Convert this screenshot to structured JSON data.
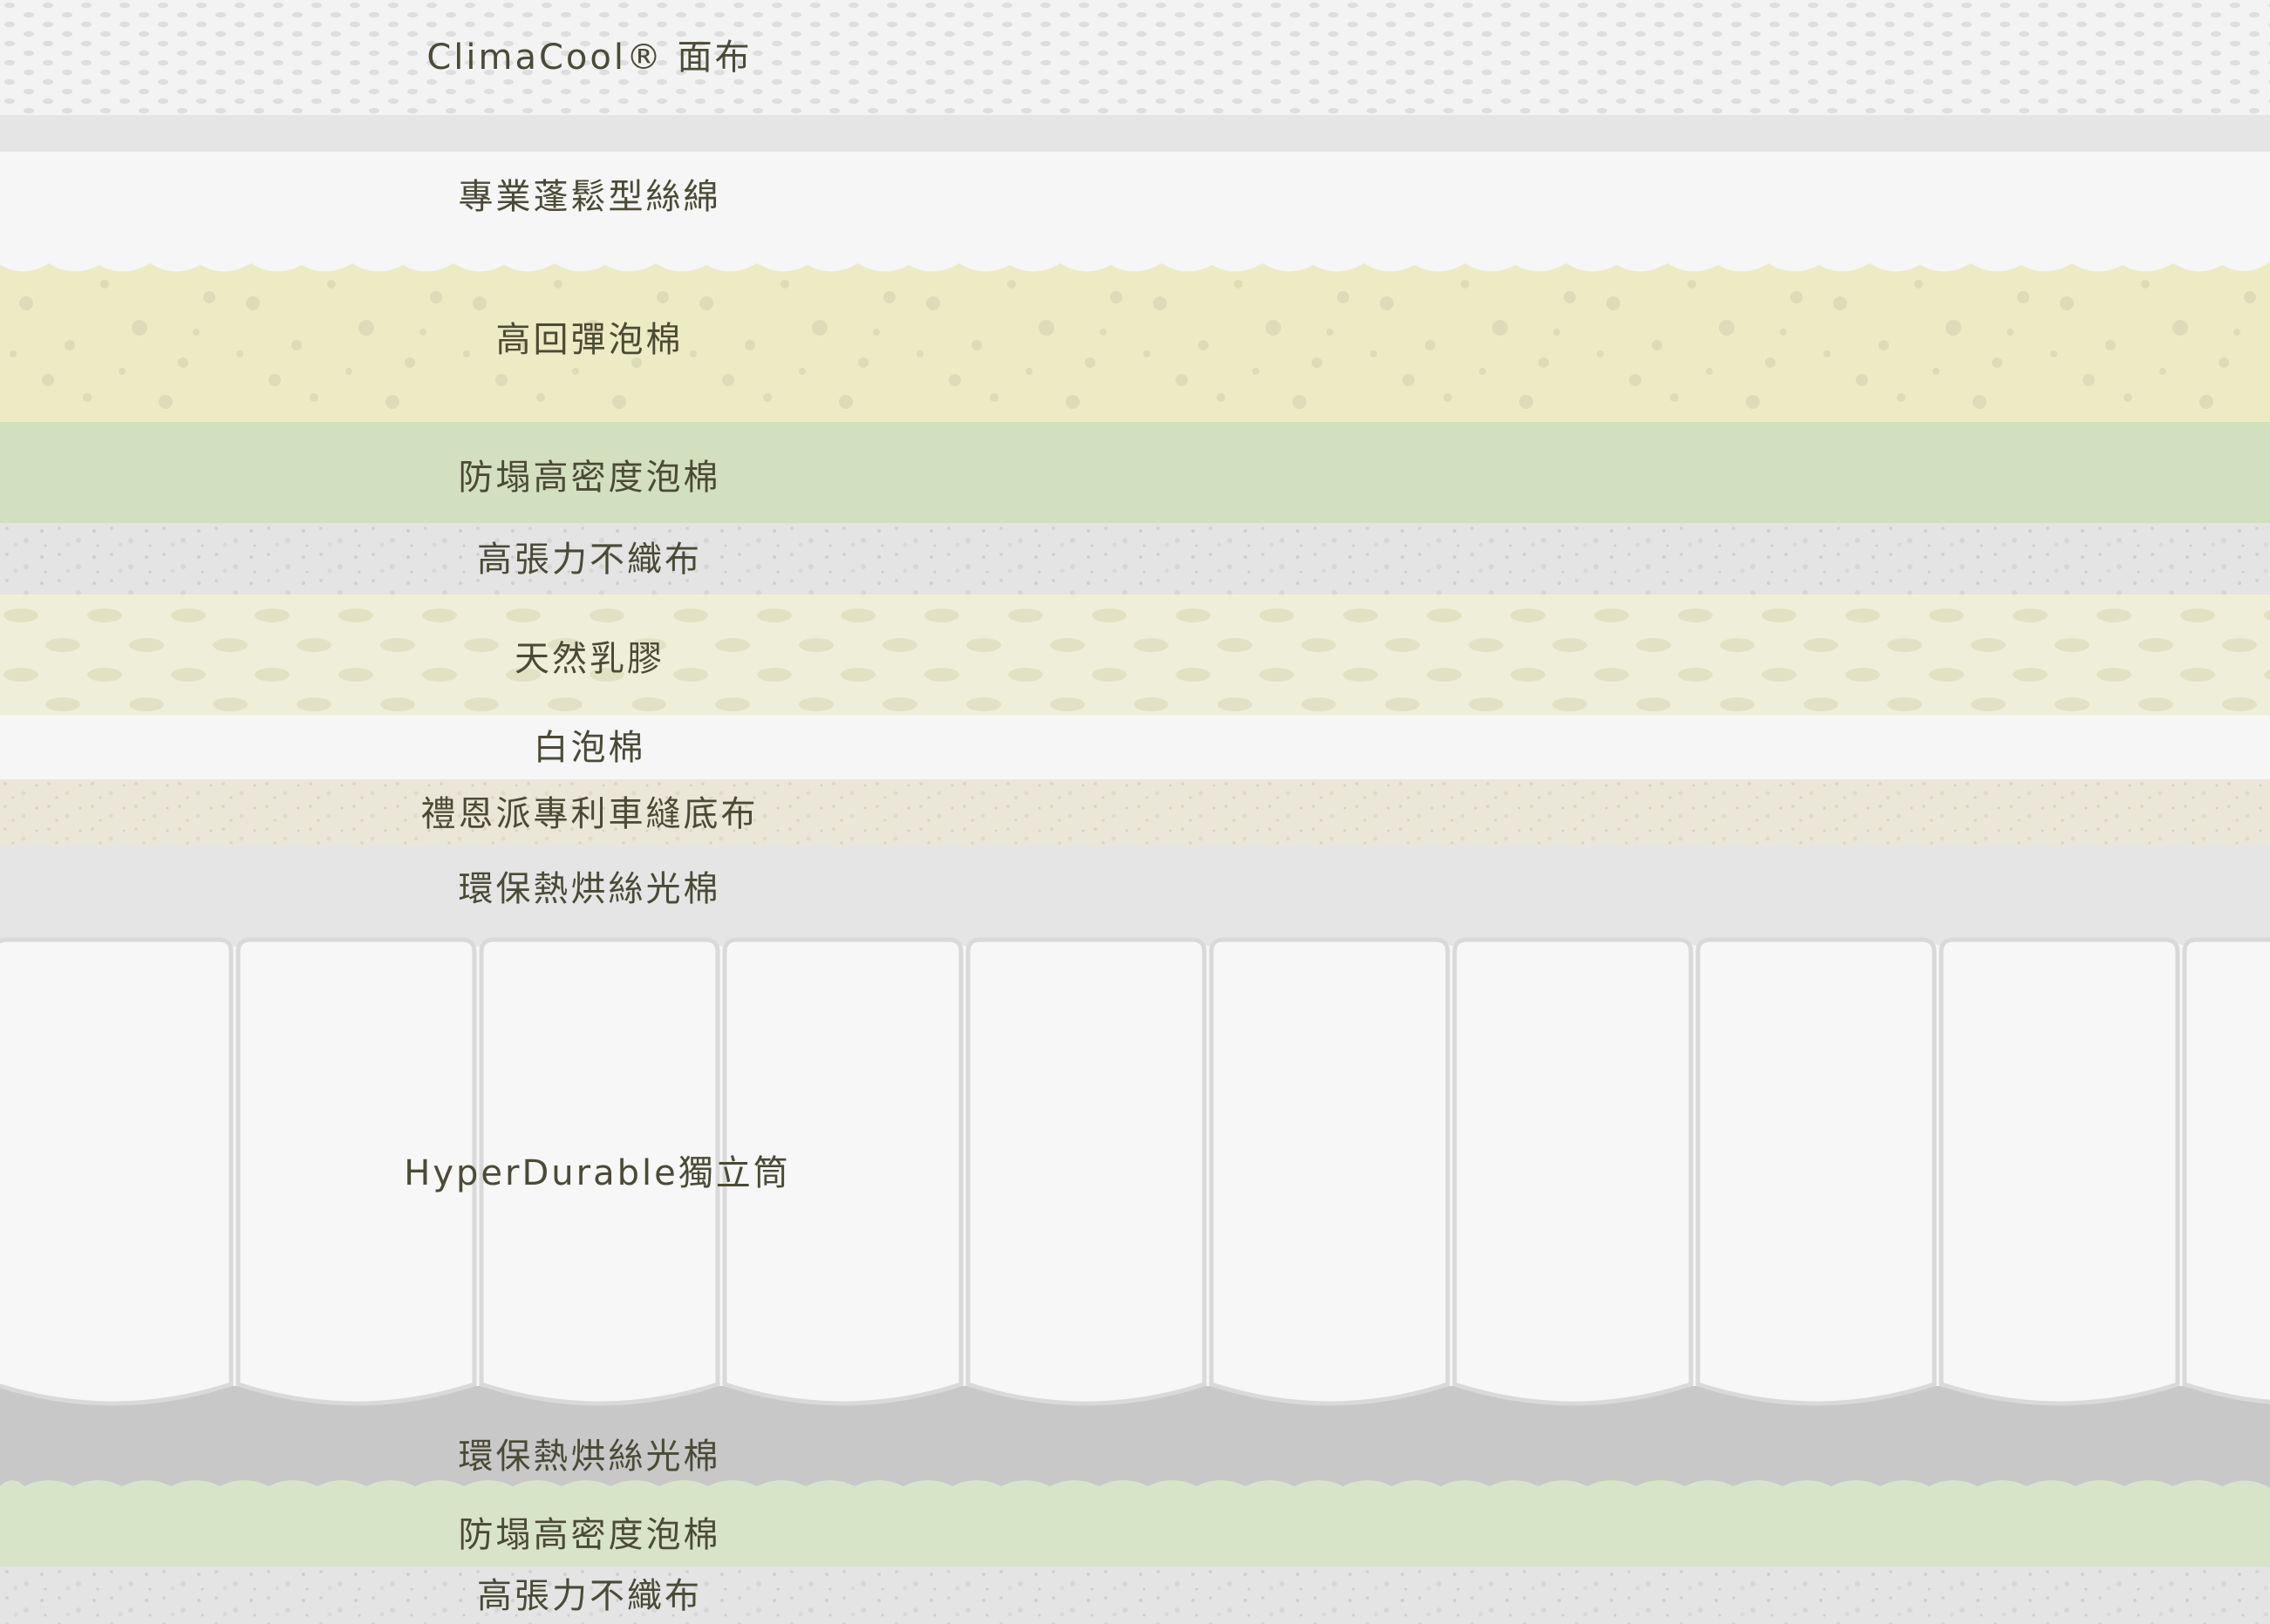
{
  "layers": [
    {
      "id": "climacool-fabric",
      "label": "ClimaCool® 面布"
    },
    {
      "id": "grey-band",
      "label": ""
    },
    {
      "id": "loft-fiber",
      "label": "專業蓬鬆型絲綿"
    },
    {
      "id": "high-resilience-foam",
      "label": "高回彈泡棉"
    },
    {
      "id": "anti-sag-foam-top",
      "label": "防塌高密度泡棉"
    },
    {
      "id": "nonwoven-top",
      "label": "高張力不織布"
    },
    {
      "id": "natural-latex",
      "label": "天然乳膠"
    },
    {
      "id": "white-foam",
      "label": "白泡棉"
    },
    {
      "id": "patent-base-cloth",
      "label": "禮恩派專利車縫底布"
    },
    {
      "id": "eco-fiber-top",
      "label": "環保熱烘絲光棉"
    },
    {
      "id": "pocket-springs",
      "label": "HyperDurable獨立筒"
    },
    {
      "id": "eco-fiber-bottom",
      "label": "環保熱烘絲光棉"
    },
    {
      "id": "anti-sag-foam-bottom",
      "label": "防塌高密度泡棉"
    },
    {
      "id": "nonwoven-bottom",
      "label": "高張力不織布"
    }
  ],
  "colors": {
    "label_text": "#4b4a35",
    "climacool": "#f3f3f3",
    "loft_fiber": "#f5f6f5",
    "resilience_foam": "#ecebc4",
    "anti_sag_foam": "#d3e0bf",
    "nonwoven": "#e4e4e4",
    "latex": "#efeed8",
    "base_cloth": "#ebe7d8",
    "eco_fiber_top": "#e5e5e5",
    "eco_fiber_bottom": "#c8c8c8",
    "springs": "#f5f6f5"
  }
}
